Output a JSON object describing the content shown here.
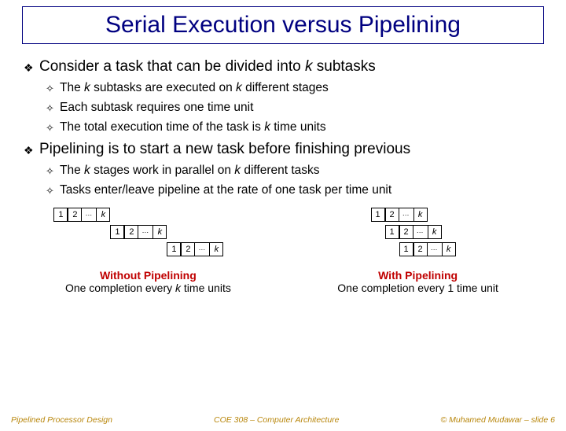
{
  "title": "Serial Execution versus Pipelining",
  "bullets": {
    "b1a": "Consider a task that can be divided into ",
    "b1a_em": "k",
    "b1a_tail": " subtasks",
    "b1a_s1_pre": "The ",
    "b1a_s1_em": "k",
    "b1a_s1_mid": " subtasks are executed on ",
    "b1a_s1_em2": "k",
    "b1a_s1_tail": " different stages",
    "b1a_s2": "Each subtask requires one time unit",
    "b1a_s3_pre": "The total execution time of the task is ",
    "b1a_s3_em": "k",
    "b1a_s3_tail": " time units",
    "b1b": "Pipelining is to start a new task before finishing previous",
    "b1b_s1_pre": "The ",
    "b1b_s1_em": "k",
    "b1b_s1_mid": " stages work in parallel on ",
    "b1b_s1_em2": "k",
    "b1b_s1_tail": " different tasks",
    "b1b_s2": "Tasks enter/leave pipeline at the rate of one task per time unit"
  },
  "cells": {
    "c1": "1",
    "c2": "2",
    "dots": "…",
    "ck": "k"
  },
  "captions": {
    "left_strong": "Without Pipelining",
    "left_sub_pre": "One completion every ",
    "left_sub_em": "k",
    "left_sub_tail": " time units",
    "right_strong": "With Pipelining",
    "right_sub": "One completion every 1 time unit"
  },
  "footer": {
    "left": "Pipelined Processor Design",
    "center": "COE 308 – Computer Architecture",
    "right": "© Muhamed Mudawar – slide 6"
  }
}
